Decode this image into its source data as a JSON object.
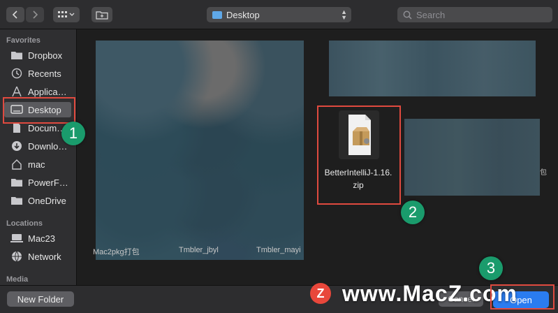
{
  "toolbar": {
    "location": "Desktop",
    "search_placeholder": "Search"
  },
  "sidebar": {
    "favorites_heading": "Favorites",
    "favorites": [
      {
        "label": "Dropbox",
        "icon": "folder-icon"
      },
      {
        "label": "Recents",
        "icon": "clock-icon"
      },
      {
        "label": "Applica…",
        "icon": "applications-icon"
      },
      {
        "label": "Desktop",
        "icon": "desktop-icon",
        "selected": true
      },
      {
        "label": "Docum…",
        "icon": "document-icon"
      },
      {
        "label": "Downlo…",
        "icon": "download-icon"
      },
      {
        "label": "mac",
        "icon": "home-icon"
      },
      {
        "label": "PowerF…",
        "icon": "folder-icon"
      },
      {
        "label": "OneDrive",
        "icon": "folder-icon"
      }
    ],
    "locations_heading": "Locations",
    "locations": [
      {
        "label": "Mac23",
        "icon": "computer-icon"
      },
      {
        "label": "Network",
        "icon": "globe-icon"
      }
    ],
    "media_heading": "Media"
  },
  "files": {
    "zip_name_line1": "BetterIntelliJ-1.16.",
    "zip_name_line2": "zip",
    "bottom_names": [
      "Mac2pkg打包",
      "Tmbler_jbyl",
      "Tmbler_mayi"
    ],
    "fragment_right": "包"
  },
  "bottom": {
    "new_folder": "New Folder",
    "cancel": "Cancel",
    "open": "Open"
  },
  "callouts": [
    "1",
    "2",
    "3"
  ],
  "watermark": {
    "logo": "Z",
    "text": "www.MacZ.com"
  },
  "colors": {
    "accent": "#2a7cf0",
    "highlight": "#e04a3f",
    "badge": "#1a9b6c"
  }
}
